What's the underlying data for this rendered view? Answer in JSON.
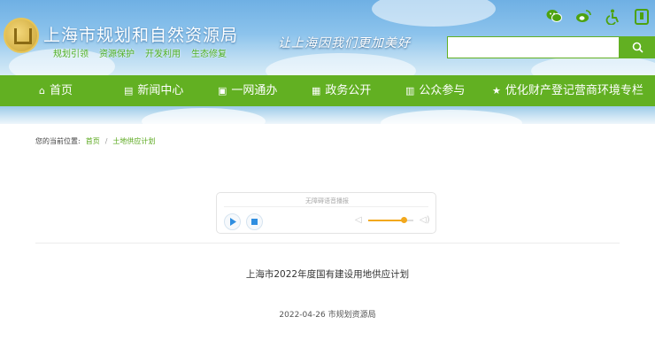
{
  "header": {
    "site_title": "上海市规划和自然资源局",
    "slogans": [
      "规划引领",
      "资源保护",
      "开发利用",
      "生态修复"
    ],
    "motto": "让上海因我们更加美好",
    "icons": [
      "wechat-icon",
      "weibo-icon",
      "accessibility-icon",
      "mobile-app-icon"
    ],
    "search": {
      "placeholder": "",
      "button_icon": "search-icon"
    },
    "colors": {
      "brand_green": "#62b022",
      "sky": "#8cc3ec"
    }
  },
  "nav": {
    "items": [
      {
        "label": "首页",
        "icon": "home-icon"
      },
      {
        "label": "新闻中心",
        "icon": "document-icon"
      },
      {
        "label": "一网通办",
        "icon": "monitor-icon"
      },
      {
        "label": "政务公开",
        "icon": "clipboard-icon"
      },
      {
        "label": "公众参与",
        "icon": "book-icon"
      },
      {
        "label": "优化财产登记营商环境专栏",
        "icon": "star-icon"
      }
    ]
  },
  "breadcrumb": {
    "prefix": "您的当前位置:",
    "items": [
      "首页",
      "土地供应计划"
    ],
    "separator": "/"
  },
  "player": {
    "title": "无障碍语音播报",
    "volume": 0.78,
    "accent_color": "#f2a81d"
  },
  "article": {
    "title": "上海市2022年度国有建设用地供应计划",
    "meta": "2022-04-26 市规划资源局"
  }
}
